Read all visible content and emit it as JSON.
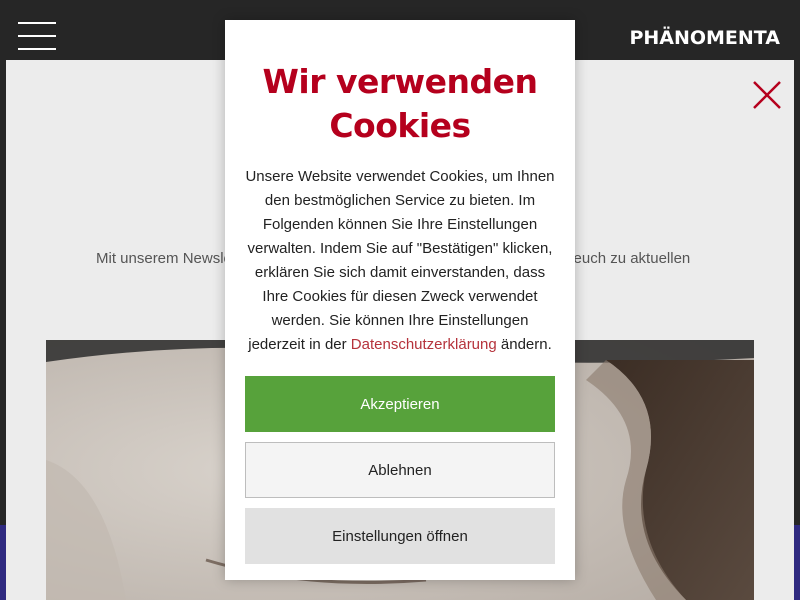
{
  "header": {
    "logo_text": "PHÄNOMENTA",
    "menu_icon": "hamburger-icon"
  },
  "page": {
    "close_icon": "close-icon",
    "newsletter_text_left": "Mit unserem Newsle",
    "newsletter_text_right": "n euch zu aktuellen"
  },
  "cookie_modal": {
    "title": "Wir verwenden Cookies",
    "body_text": "Unsere Website verwendet Cookies, um Ihnen den bestmöglichen Service zu bieten. Im Folgenden können Sie Ihre Einstellungen verwalten. Indem Sie auf \"Bestätigen\" klicken, erklären Sie sich damit einverstanden, dass Ihre Cookies für diesen Zweck verwendet werden. Sie können Ihre Einstellungen jederzeit in der",
    "privacy_link": "Datenschutzerklärung",
    "body_suffix": "ändern.",
    "accept_label": "Akzeptieren",
    "decline_label": "Ablehnen",
    "settings_label": "Einstellungen öffnen"
  },
  "colors": {
    "title_red": "#b5001d",
    "link_red": "#b5323b",
    "accept_green": "#57a23b",
    "header_dark": "#262626"
  }
}
